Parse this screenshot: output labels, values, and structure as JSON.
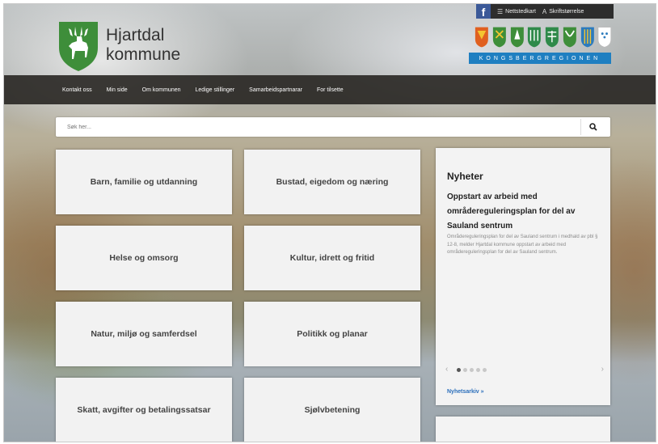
{
  "header": {
    "site_name_line1": "Hjartdal",
    "site_name_line2": "kommune",
    "logo_icon": "deer-shield-icon",
    "utility": {
      "facebook_label": "f",
      "sitemap_label": "Nettstedkart",
      "fontsize_label": "Skriftstørrelse"
    },
    "region_label": "KONGSBERGREGIONEN"
  },
  "nav": {
    "items": [
      "Kontakt oss",
      "Min side",
      "Om kommunen",
      "Ledige stillinger",
      "Samarbeidspartnarar",
      "For tilsette"
    ]
  },
  "search": {
    "placeholder": "Søk her..."
  },
  "tiles": [
    "Barn, familie og utdanning",
    "Bustad, eigedom og næring",
    "Helse og omsorg",
    "Kultur, idrett og fritid",
    "Natur, miljø og samferdsel",
    "Politikk og planar",
    "Skatt, avgifter og betalingssatsar",
    "Sjølvbetening"
  ],
  "news": {
    "title": "Nyheter",
    "headline": "Oppstart av arbeid med områdereguleringsplan for del av Sauland sentrum",
    "body": "Områdereguleringsplan for del av Sauland sentrum i medhald av pbl § 12-8, melder Hjartdal kommune oppstart av arbeid med områdereguleringsplan for del av Sauland sentrum.",
    "prev": "‹",
    "next": "›",
    "archive_label": "Nyhetsarkiv »"
  },
  "colors": {
    "nav_bg": "#28261f",
    "accent_blue": "#1f7fc1",
    "logo_green": "#3e8e3a",
    "link_blue": "#2a6ebb"
  }
}
